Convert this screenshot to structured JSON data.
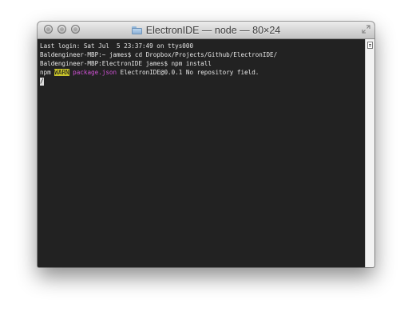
{
  "window": {
    "title": "ElectronIDE — node — 80×24"
  },
  "terminal": {
    "lines": [
      "Last login: Sat Jul  5 23:37:49 on ttys000",
      "Baldengineer-MBP:~ james$ cd Dropbox/Projects/Github/ElectronIDE/",
      "Baldengineer-MBP:ElectronIDE james$ npm install"
    ],
    "warn_line": {
      "prefix": "npm ",
      "badge": "WARN",
      "file": "package.json",
      "message": " ElectronIDE@0.0.1 No repository field."
    },
    "spinner_char": "/"
  },
  "colors": {
    "terminal_bg": "#222222",
    "text": "#e6e6e6",
    "warn_bg": "#c7c32b",
    "magenta": "#d152d6"
  },
  "icons": {
    "title": "folder-icon",
    "fullscreen": "resize-icon",
    "scroll": "scroll-handle-icon"
  }
}
